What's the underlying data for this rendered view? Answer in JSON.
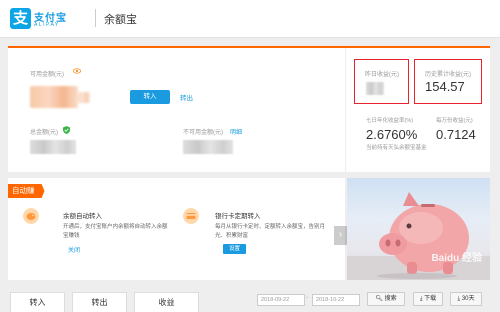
{
  "header": {
    "logo_glyph": "支",
    "logo_cn": "支付宝",
    "logo_en": "ALIPAY",
    "product": "余额宝"
  },
  "account": {
    "available_label": "可用金额(元)",
    "transfer_in": "转入",
    "transfer_out": "转出",
    "total_label": "总金额(元)",
    "unavailable_label": "不可用金额(元)",
    "details_link": "明细"
  },
  "income": {
    "yesterday_label": "昨日收益(元)",
    "total_label": "历史累计收益(元)",
    "total_value": "154.57",
    "annual_label": "七日年化收益率(%)",
    "annual_value": "2.6760%",
    "per_10k_label": "每万份收益(元)",
    "per_10k_value": "0.7124",
    "note": "当前持有天弘余额宝基金"
  },
  "auto": {
    "tag": "自动赚",
    "feature1_title": "余额自动转入",
    "feature1_desc": "开通后，支付宝账户内余额将自动转入余额宝赚钱",
    "feature1_action": "关闭",
    "feature2_title": "银行卡定期转入",
    "feature2_desc": "每月从银行卡定时、定额转入余额宝，告别月光、积累财富",
    "feature2_action": "设置"
  },
  "promo": {
    "watermark": "Baidu 经验"
  },
  "bottom": {
    "tab_in": "转入",
    "tab_out": "转出",
    "tab_income": "收益",
    "date_from": "2018-09-22",
    "date_sep": "-",
    "date_to": "2018-10-22",
    "search": "搜索",
    "download": "下载",
    "days30": "30天"
  },
  "colors": {
    "brand_blue": "#1a9be0",
    "accent_orange": "#ff6600",
    "highlight_red": "#e8232d"
  }
}
